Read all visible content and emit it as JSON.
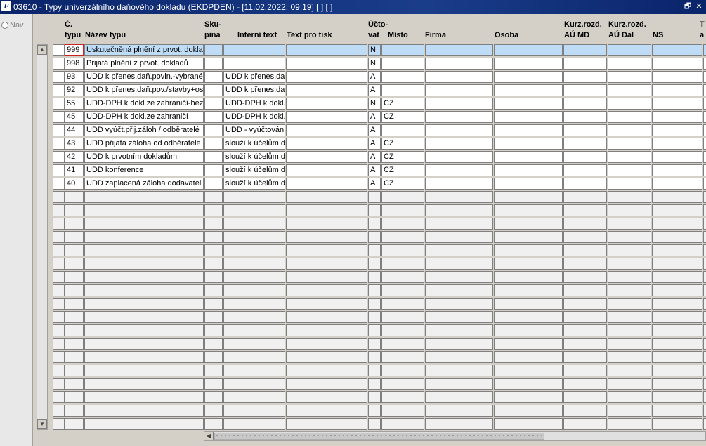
{
  "window": {
    "title": "03610 - Typy univerzálního daňového dokladu (EKDPDEN) - [11.02.2022; 09:19]  [ ]  [ ]",
    "restore_glyph": "🗗",
    "close_glyph": "✕"
  },
  "sidebar": {
    "nav_label": "Nav"
  },
  "columns": [
    {
      "key": "num",
      "label": "Č.\ntypu"
    },
    {
      "key": "name",
      "label": "Název typu"
    },
    {
      "key": "group",
      "label": "Sku-\npina"
    },
    {
      "key": "internal",
      "label": "Interní text"
    },
    {
      "key": "print",
      "label": "Text pro tisk"
    },
    {
      "key": "acc",
      "label": "Účto-\nvat"
    },
    {
      "key": "place",
      "label": "Místo"
    },
    {
      "key": "company",
      "label": "Firma"
    },
    {
      "key": "person",
      "label": "Osoba"
    },
    {
      "key": "kmd",
      "label": "Kurz.rozd.\nAÚ MD"
    },
    {
      "key": "kdal",
      "label": "Kurz.rozd.\nAÚ Dal"
    },
    {
      "key": "ns",
      "label": "NS"
    },
    {
      "key": "extra",
      "label": "T\na"
    }
  ],
  "rows": [
    {
      "num": "999",
      "name": "Uskutečněná plnění z prvot. dokladů",
      "group": "",
      "internal": "",
      "print": "",
      "acc": "N",
      "place": "",
      "company": "",
      "person": "",
      "kmd": "",
      "kdal": "",
      "ns": "",
      "extra": ""
    },
    {
      "num": "998",
      "name": "Přijatá plnění z prvot. dokladů",
      "group": "",
      "internal": "",
      "print": "",
      "acc": "N",
      "place": "",
      "company": "",
      "person": "",
      "kmd": "",
      "kdal": "",
      "ns": "",
      "extra": ""
    },
    {
      "num": "93",
      "name": "UDD k přenes.daň.povin.-vybrané",
      "group": "",
      "internal": "UDD k přenes.daň",
      "print": "",
      "acc": "A",
      "place": "",
      "company": "",
      "person": "",
      "kmd": "",
      "kdal": "",
      "ns": "",
      "extra": ""
    },
    {
      "num": "92",
      "name": "UDD k přenes.daň.pov./stavby+ost",
      "group": "",
      "internal": "UDD k přenes.daň",
      "print": "",
      "acc": "A",
      "place": "",
      "company": "",
      "person": "",
      "kmd": "",
      "kdal": "",
      "ns": "",
      "extra": ""
    },
    {
      "num": "55",
      "name": "UDD-DPH k dokl.ze zahraničí-bez d",
      "group": "",
      "internal": "UDD-DPH k dokl.ze",
      "print": "",
      "acc": "N",
      "place": "CZ",
      "company": "",
      "person": "",
      "kmd": "",
      "kdal": "",
      "ns": "",
      "extra": ""
    },
    {
      "num": "45",
      "name": "UDD-DPH k dokl.ze zahraničí",
      "group": "",
      "internal": "UDD-DPH k dokl.ze",
      "print": "",
      "acc": "A",
      "place": "CZ",
      "company": "",
      "person": "",
      "kmd": "",
      "kdal": "",
      "ns": "",
      "extra": ""
    },
    {
      "num": "44",
      "name": "UDD vyúčt.přij.záloh / odběratelé",
      "group": "",
      "internal": "UDD - vyúčtování",
      "print": "",
      "acc": "A",
      "place": "",
      "company": "",
      "person": "",
      "kmd": "",
      "kdal": "",
      "ns": "",
      "extra": ""
    },
    {
      "num": "43",
      "name": "UDD přijatá záloha od odběratele",
      "group": "",
      "internal": "slouží k účelům do",
      "print": "",
      "acc": "A",
      "place": "CZ",
      "company": "",
      "person": "",
      "kmd": "",
      "kdal": "",
      "ns": "",
      "extra": ""
    },
    {
      "num": "42",
      "name": "UDD k prvotním dokladům",
      "group": "",
      "internal": "slouží k účelům do",
      "print": "",
      "acc": "A",
      "place": "CZ",
      "company": "",
      "person": "",
      "kmd": "",
      "kdal": "",
      "ns": "",
      "extra": ""
    },
    {
      "num": "41",
      "name": "UDD konference",
      "group": "",
      "internal": "slouží k účelům do",
      "print": "",
      "acc": "A",
      "place": "CZ",
      "company": "",
      "person": "",
      "kmd": "",
      "kdal": "",
      "ns": "",
      "extra": ""
    },
    {
      "num": "40",
      "name": "UDD zaplacená záloha dodavateli",
      "group": "",
      "internal": "slouží k účelům do",
      "print": "",
      "acc": "A",
      "place": "CZ",
      "company": "",
      "person": "",
      "kmd": "",
      "kdal": "",
      "ns": "",
      "extra": ""
    }
  ],
  "scroll": {
    "up": "▲",
    "down": "▼",
    "left": "◀"
  }
}
